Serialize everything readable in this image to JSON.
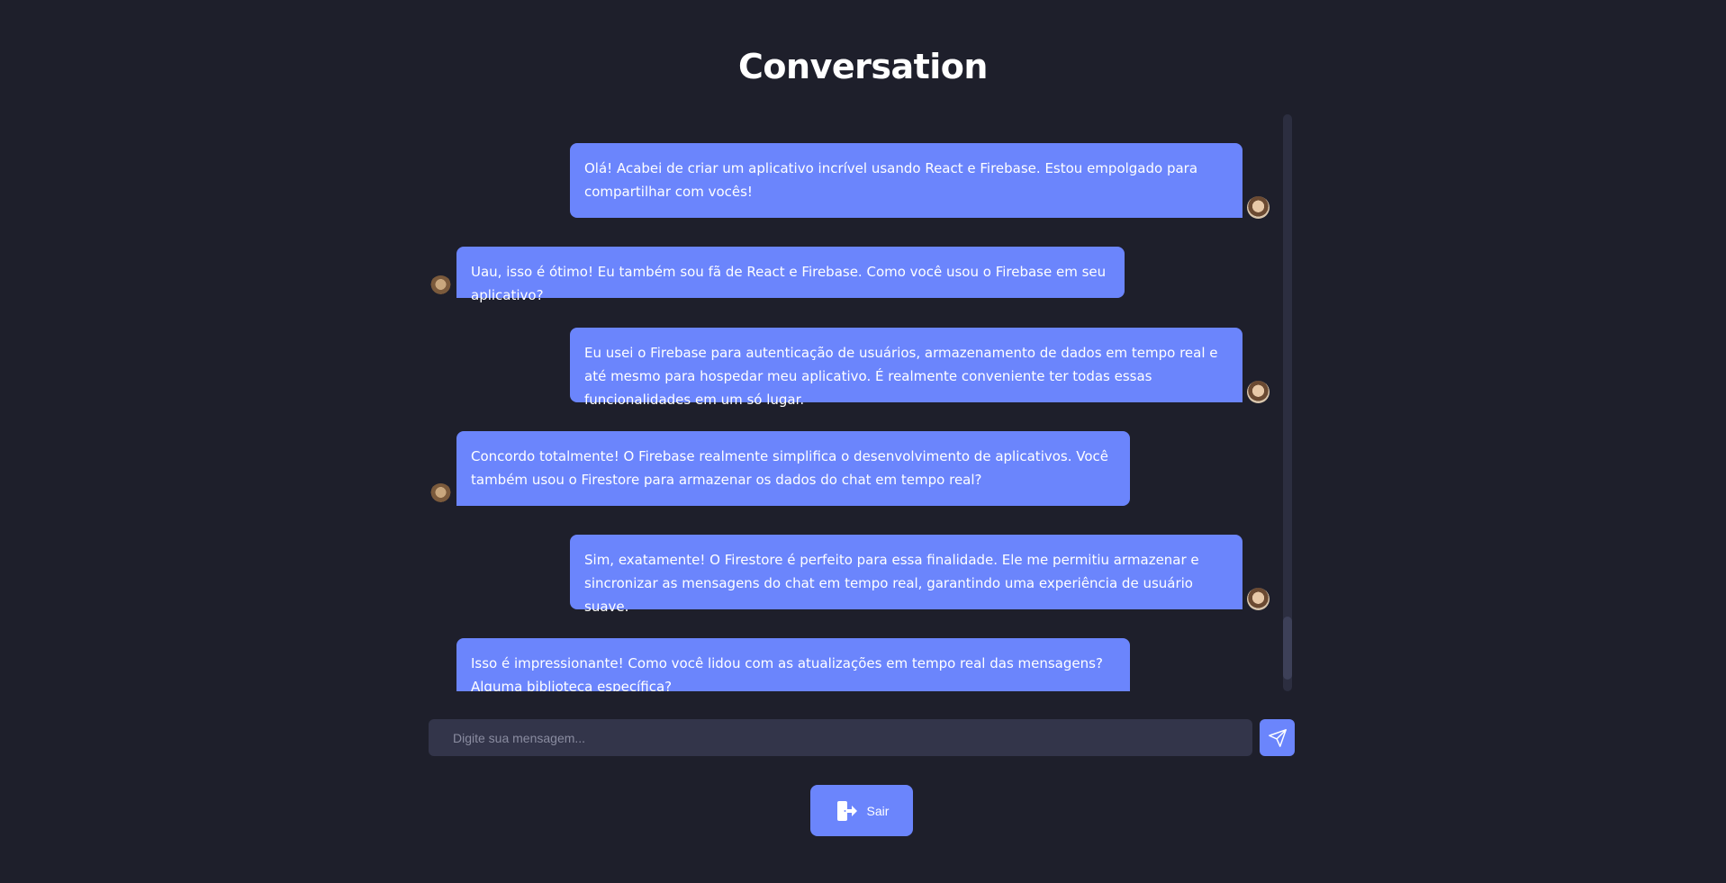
{
  "page": {
    "title": "Conversation"
  },
  "messages": [
    {
      "side": "sent",
      "avatar": "woman-avatar",
      "text": "Olá! Acabei de criar um aplicativo incrível usando React e Firebase. Estou empolgado para compartilhar com vocês!"
    },
    {
      "side": "received",
      "avatar": "man-avatar",
      "text": "Uau, isso é ótimo! Eu também sou fã de React e Firebase. Como você usou o Firebase em seu aplicativo?"
    },
    {
      "side": "sent",
      "avatar": "woman-avatar",
      "text": "Eu usei o Firebase para autenticação de usuários, armazenamento de dados em tempo real e até mesmo para hospedar meu aplicativo. É realmente conveniente ter todas essas funcionalidades em um só lugar."
    },
    {
      "side": "received",
      "avatar": "man-avatar",
      "text": "Concordo totalmente! O Firebase realmente simplifica o desenvolvimento de aplicativos. Você também usou o Firestore para armazenar os dados do chat em tempo real?"
    },
    {
      "side": "sent",
      "avatar": "woman-avatar",
      "text": "Sim, exatamente! O Firestore é perfeito para essa finalidade. Ele me permitiu armazenar e sincronizar as mensagens do chat em tempo real, garantindo uma experiência de usuário suave."
    },
    {
      "side": "received",
      "avatar": "man-avatar",
      "text": "Isso é impressionante! Como você lidou com as atualizações em tempo real das mensagens? Alguma biblioteca específica?"
    }
  ],
  "composer": {
    "placeholder": "Digite sua mensagem...",
    "send_icon": "paper-plane-icon"
  },
  "logout": {
    "label": "Sair",
    "icon": "logout-door-icon"
  },
  "colors": {
    "background": "#1e1f2b",
    "bubble": "#6b85fc",
    "input": "#33354a"
  }
}
